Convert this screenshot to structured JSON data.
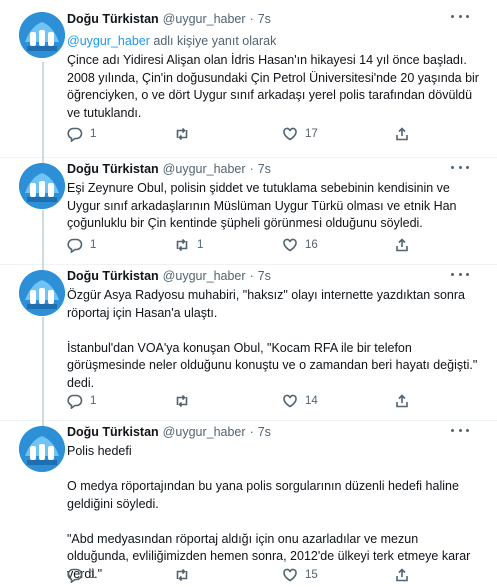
{
  "author": {
    "name": "Doğu Türkistan",
    "handle": "@uygur_haber",
    "separator": "·"
  },
  "reply_context": {
    "mention": "@uygur_haber",
    "suffix": " adlı kişiye yanıt olarak"
  },
  "tweets": [
    {
      "time": "7s",
      "paragraphs": [
        "Çince adı Yidiresi Alişan olan İdris Hasan'ın hikayesi 14 yıl önce başladı. 2008 yılında, Çin'in doğusundaki Çin Petrol Üniversitesi'nde 20 yaşında bir öğrenciyken, o ve dört Uygur sınıf arkadaşı yerel polis tarafından dövüldü ve tutuklandı."
      ],
      "replies": "1",
      "retweets": "",
      "likes": "17"
    },
    {
      "time": "7s",
      "paragraphs": [
        "Eşi Zeynure Obul, polisin şiddet ve tutuklama sebebinin kendisinin ve Uygur sınıf arkadaşlarının Müslüman Uygur Türkü olması ve etnik Han çoğunluklu bir Çin kentinde şüpheli görünmesi olduğunu söyledi."
      ],
      "replies": "1",
      "retweets": "1",
      "likes": "16"
    },
    {
      "time": "7s",
      "paragraphs": [
        "Özgür Asya Radyosu muhabiri, \"haksız\" olayı internette yazdıktan sonra röportaj için Hasan'a ulaştı.",
        "İstanbul'dan VOA'ya konuşan Obul, \"Kocam RFA ile bir telefon görüşmesinde neler olduğunu konuştu ve o zamandan beri hayatı değişti.\" dedi."
      ],
      "replies": "1",
      "retweets": "",
      "likes": "14"
    },
    {
      "time": "7s",
      "paragraphs": [
        "Polis hedefi",
        "O medya röportajından bu yana polis sorgularının düzenli hedefi haline geldiğini söyledi.",
        "\"Abd medyasından röportaj aldığı için onu azarladılar ve mezun olduğunda, evliliğimizden hemen sonra, 2012'de ülkeyi terk etmeye karar verdi.\""
      ],
      "replies": "1",
      "retweets": "",
      "likes": "15"
    }
  ]
}
